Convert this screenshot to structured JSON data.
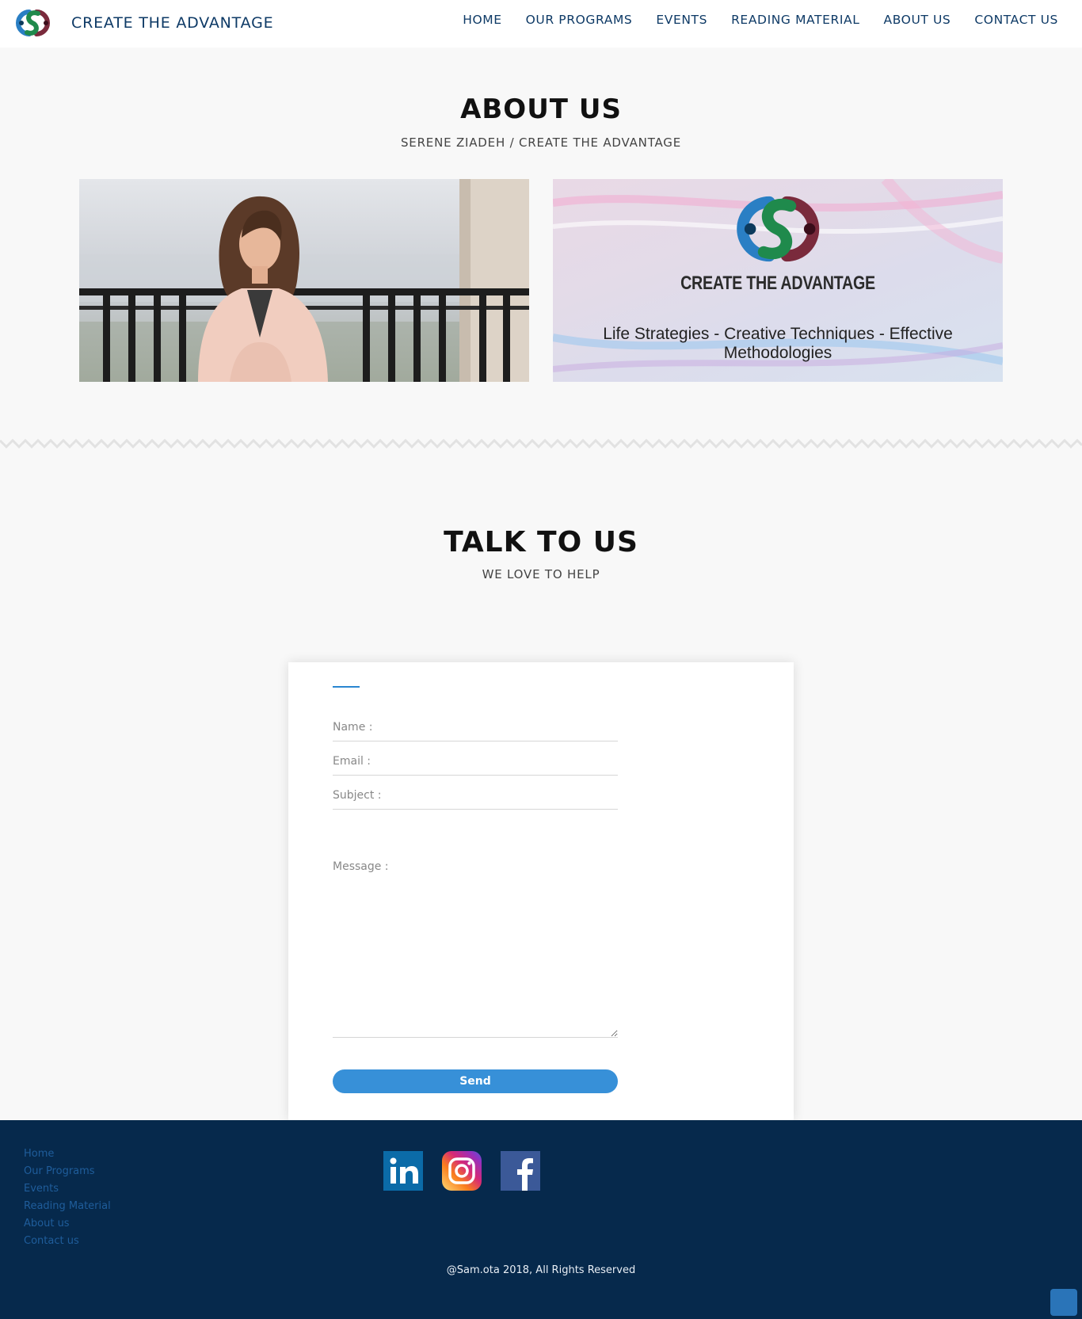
{
  "header": {
    "brand": "CREATE THE ADVANTAGE",
    "logo_icon": "create-the-advantage-logo",
    "nav": [
      "HOME",
      "OUR PROGRAMS",
      "EVENTS",
      "READING MATERIAL",
      "ABOUT US",
      "CONTACT US"
    ]
  },
  "about": {
    "title": "ABOUT US",
    "subtitle": "SERENE ZIADEH / CREATE THE ADVANTAGE",
    "banner_brand": "CREATE THE ADVANTAGE",
    "banner_tagline": "Life Strategies - Creative Techniques - Effective Methodologies"
  },
  "contact": {
    "title": "TALK TO US",
    "subtitle": "WE LOVE TO HELP",
    "name_placeholder": "Name :",
    "email_placeholder": "Email :",
    "subject_placeholder": "Subject :",
    "message_placeholder": "Message :",
    "send_label": "Send"
  },
  "footer": {
    "links": [
      "Home",
      "Our Programs",
      "Events",
      "Reading Material",
      "About us",
      "Contact us"
    ],
    "social": [
      "linkedin-icon",
      "instagram-icon",
      "facebook-icon"
    ],
    "copyright": "@Sam.ota 2018,  All Rights Reserved"
  },
  "colors": {
    "brand_navy": "#0e3a66",
    "accent_blue": "#3790d8",
    "footer_bg": "#06294c",
    "footer_link": "#1f5d9b",
    "logo_blue": "#2a7fc4",
    "logo_green": "#1f8a4c",
    "logo_maroon": "#7a2a3c"
  }
}
